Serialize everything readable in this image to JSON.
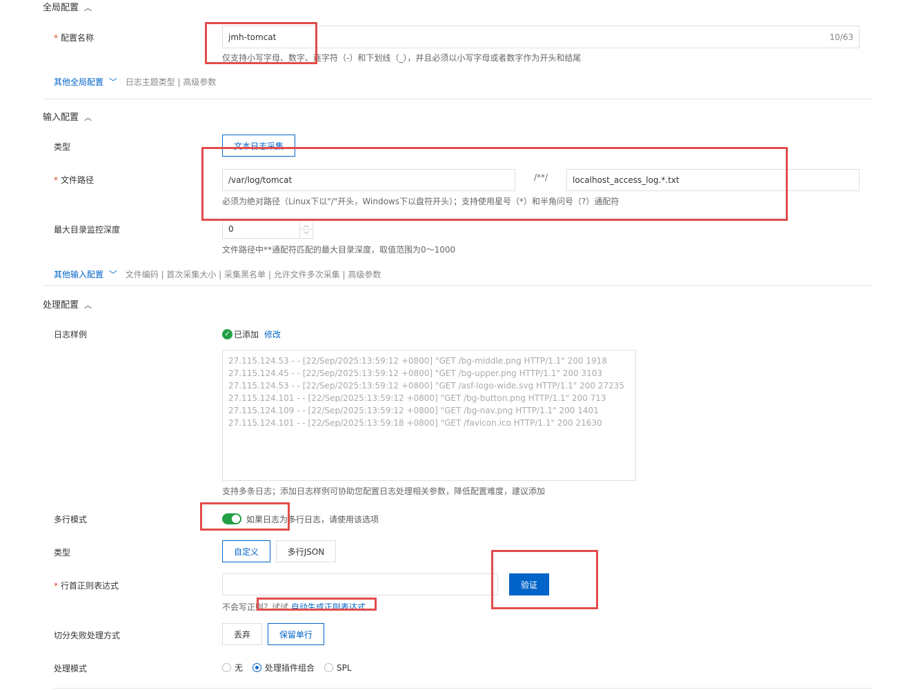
{
  "global": {
    "section_title": "全局配置",
    "config_name_label": "配置名称",
    "config_name_value": "jmh-tomcat",
    "config_name_count": "10/63",
    "config_name_hint": "仅支持小写字母、数字、连字符（-）和下划线（_），并且必须以小写字母或者数字作为开头和结尾",
    "other_link": "其他全局配置",
    "other_items": "日志主题类型 | 高级参数"
  },
  "input": {
    "section_title": "输入配置",
    "type_label": "类型",
    "type_value": "文本日志采集",
    "path_label": "文件路径",
    "path_dir": "/var/log/tomcat",
    "path_sep": "/**/",
    "path_file": "localhost_access_log.*.txt",
    "path_hint": "必须为绝对路径（Linux下以\"/\"开头，Windows下以盘符开头）；支持使用星号（*）和半角问号（?）通配符",
    "depth_label": "最大目录监控深度",
    "depth_value": "0",
    "depth_hint": "文件路径中**通配符匹配的最大目录深度，取值范围为0～1000",
    "other_link": "其他输入配置",
    "other_items": "文件编码 | 首次采集大小 | 采集黑名单 | 允许文件多次采集 | 高级参数"
  },
  "process": {
    "section_title": "处理配置",
    "sample_label": "日志样例",
    "sample_status": "已添加",
    "sample_edit": "修改",
    "sample_lines": [
      "27.115.124.53 - - [22/Sep/2025:13:59:12 +0800] \"GET /bg-middle.png HTTP/1.1\" 200 1918",
      "27.115.124.45 - - [22/Sep/2025:13:59:12 +0800] \"GET /bg-upper.png HTTP/1.1\" 200 3103",
      "27.115.124.53 - - [22/Sep/2025:13:59:12 +0800] \"GET /asf-logo-wide.svg HTTP/1.1\" 200 27235",
      "27.115.124.101 - - [22/Sep/2025:13:59:12 +0800] \"GET /bg-button.png HTTP/1.1\" 200 713",
      "27.115.124.109 - - [22/Sep/2025:13:59:12 +0800] \"GET /bg-nav.png HTTP/1.1\" 200 1401",
      "27.115.124.101 - - [22/Sep/2025:13:59:18 +0800] \"GET /favicon.ico HTTP/1.1\" 200 21630"
    ],
    "sample_hint": "支持多条日志；添加日志样例可协助您配置日志处理相关参数，降低配置难度，建议添加",
    "multiline_label": "多行模式",
    "multiline_hint": "如果日志为多行日志，请使用该选项",
    "type_label": "类型",
    "type_custom": "自定义",
    "type_json": "多行JSON",
    "regex_label": "行首正则表达式",
    "regex_value": "",
    "verify_button": "验证",
    "regex_hint_prefix": "不会写正则？试试",
    "regex_hint_link": "自动生成正则表达式",
    "fail_label": "切分失败处理方式",
    "fail_discard": "丢弃",
    "fail_keep": "保留单行",
    "mode_label": "处理模式",
    "mode_none": "无",
    "mode_plugins": "处理插件组合",
    "mode_spl": "SPL"
  },
  "colors": {
    "accent": "#0064c8",
    "annotation": "#e24b4b",
    "success": "#23a046"
  }
}
